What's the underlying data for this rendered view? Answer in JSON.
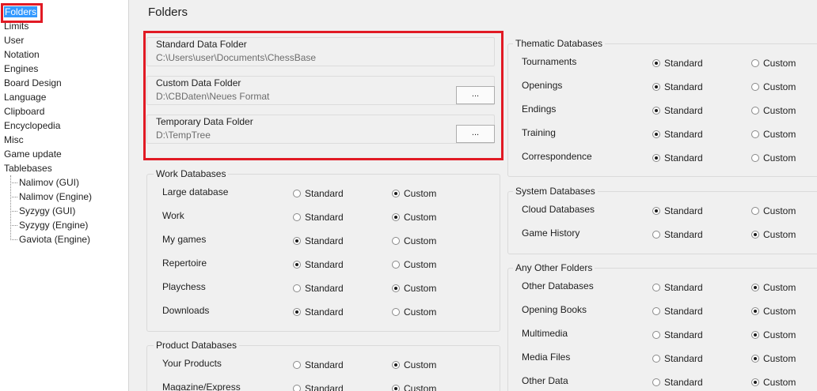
{
  "sidebar": {
    "items": [
      {
        "label": "Folders",
        "selected": true
      },
      {
        "label": "Limits"
      },
      {
        "label": "User"
      },
      {
        "label": "Notation"
      },
      {
        "label": "Engines"
      },
      {
        "label": "Board Design"
      },
      {
        "label": "Language"
      },
      {
        "label": "Clipboard"
      },
      {
        "label": "Encyclopedia"
      },
      {
        "label": "Misc"
      },
      {
        "label": "Game update"
      },
      {
        "label": "Tablebases"
      }
    ],
    "children": [
      {
        "label": "Nalimov (GUI)"
      },
      {
        "label": "Nalimov (Engine)"
      },
      {
        "label": "Syzygy (GUI)"
      },
      {
        "label": "Syzygy (Engine)"
      },
      {
        "label": "Gaviota (Engine)"
      }
    ]
  },
  "page": {
    "title": "Folders"
  },
  "folders": {
    "standard": {
      "label": "Standard Data Folder",
      "path": "C:\\Users\\user\\Documents\\ChessBase"
    },
    "custom": {
      "label": "Custom Data Folder",
      "path": "D:\\CBDaten\\Neues Format",
      "button": "..."
    },
    "temp": {
      "label": "Temporary Data Folder",
      "path": "D:\\TempTree",
      "button": "..."
    }
  },
  "radio_labels": {
    "standard": "Standard",
    "custom": "Custom"
  },
  "work": {
    "title": "Work Databases",
    "rows": [
      {
        "label": "Large database",
        "value": "custom"
      },
      {
        "label": "Work",
        "value": "custom"
      },
      {
        "label": "My games",
        "value": "standard"
      },
      {
        "label": "Repertoire",
        "value": "standard"
      },
      {
        "label": "Playchess",
        "value": "custom"
      },
      {
        "label": "Downloads",
        "value": "standard"
      }
    ]
  },
  "product": {
    "title": "Product Databases",
    "rows": [
      {
        "label": "Your Products",
        "value": "custom"
      },
      {
        "label": "Magazine/Express",
        "value": "custom"
      }
    ]
  },
  "thematic": {
    "title": "Thematic Databases",
    "rows": [
      {
        "label": "Tournaments",
        "value": "standard"
      },
      {
        "label": "Openings",
        "value": "standard"
      },
      {
        "label": "Endings",
        "value": "standard"
      },
      {
        "label": "Training",
        "value": "standard"
      },
      {
        "label": "Correspondence",
        "value": "standard"
      }
    ]
  },
  "system": {
    "title": "System Databases",
    "rows": [
      {
        "label": "Cloud Databases",
        "value": "standard"
      },
      {
        "label": "Game History",
        "value": "custom"
      }
    ]
  },
  "other": {
    "title": "Any Other Folders",
    "rows": [
      {
        "label": "Other Databases",
        "value": "custom"
      },
      {
        "label": "Opening Books",
        "value": "custom"
      },
      {
        "label": "Multimedia",
        "value": "custom"
      },
      {
        "label": "Media Files",
        "value": "custom"
      },
      {
        "label": "Other Data",
        "value": "custom"
      }
    ]
  },
  "colors": {
    "selection": "#3399ff",
    "highlight": "#e11a24"
  }
}
